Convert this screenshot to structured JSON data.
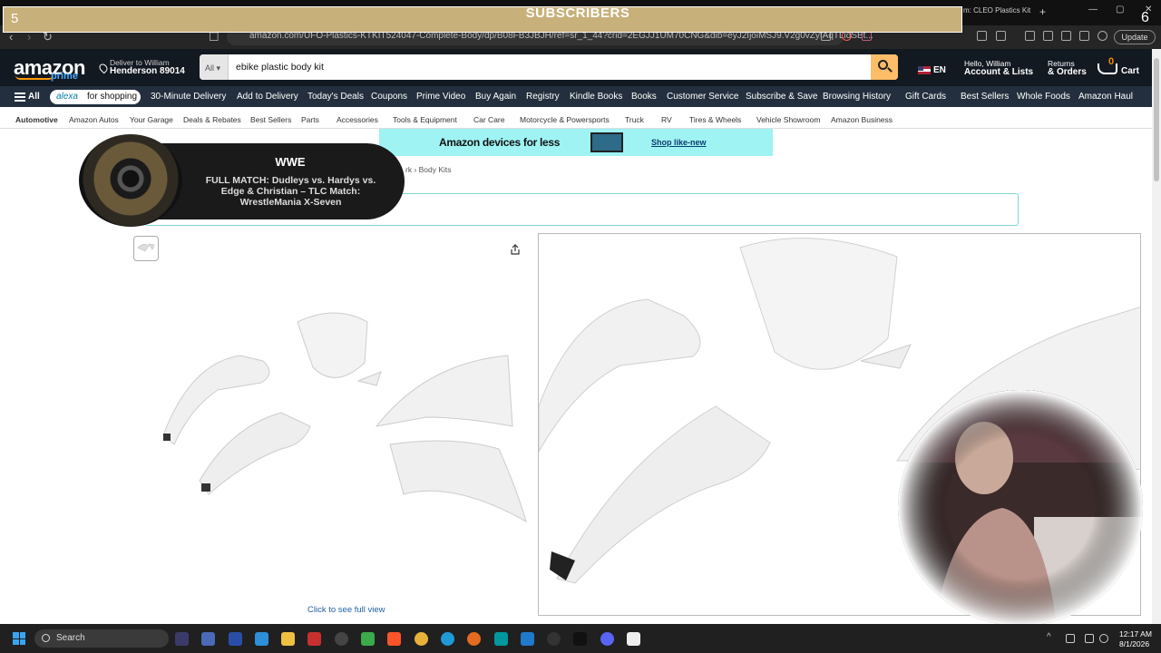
{
  "overlay": {
    "banner_title": "SUBSCRIBERS",
    "left_count": "5",
    "right_count": "6",
    "wwe_title": "WWE",
    "wwe_subtitle": "FULL MATCH: Dudleys vs. Hardys vs. Edge & Christian – TLC Match: WrestleMania X-Seven"
  },
  "browser": {
    "url": "amazon.com/UFO-Plastics-KTKIT524047-Complete-Body/dp/B08FB3JBJH/ref=sr_1_44?crid=2EGJJ1UM70CNG&dib=eyJ2IjoiMSJ9.V2g0vZyfAqTLidSBt...",
    "tab_right_label": "m: CLEO Plastics Kit",
    "update_label": "Update"
  },
  "amazon": {
    "logo": "amazon",
    "logo_prime": "prime",
    "deliver_line1": "Deliver to William",
    "deliver_line2": "Henderson 89014",
    "search_category": "All",
    "search_value": "ebike plastic body kit",
    "lang": "EN",
    "account_line1": "Hello, William",
    "account_line2": "Account & Lists",
    "returns_line1": "Returns",
    "returns_line2": "& Orders",
    "cart_count": "0",
    "cart_label": "Cart"
  },
  "nav": {
    "all": "All",
    "alexa_a": "alexa",
    "alexa_b": "for shopping",
    "items": [
      "30-Minute Delivery",
      "Add to Delivery",
      "Today's Deals",
      "Coupons",
      "Prime Video",
      "Buy Again",
      "Registry",
      "Kindle Books",
      "Books",
      "Customer Service",
      "Subscribe & Save",
      "Browsing History",
      "Gift Cards",
      "Best Sellers",
      "Whole Foods",
      "Amazon Haul"
    ]
  },
  "subnav": {
    "items": [
      "Automotive",
      "Amazon Autos",
      "Your Garage",
      "Deals & Rebates",
      "Best Sellers",
      "Parts",
      "Accessories",
      "Tools & Equipment",
      "Car Care",
      "Motorcycle & Powersports",
      "Truck",
      "RV",
      "Tires & Wheels",
      "Vehicle Showroom",
      "Amazon Business"
    ]
  },
  "ad": {
    "title": "Amazon devices for less",
    "link": "Shop like-new"
  },
  "breadcrumb": "rk › Body Kits",
  "product": {
    "click_full_view": "Click to see full view"
  },
  "taskbar": {
    "search": "Search",
    "time": "12:17 AM",
    "date": "8/1/2026"
  }
}
